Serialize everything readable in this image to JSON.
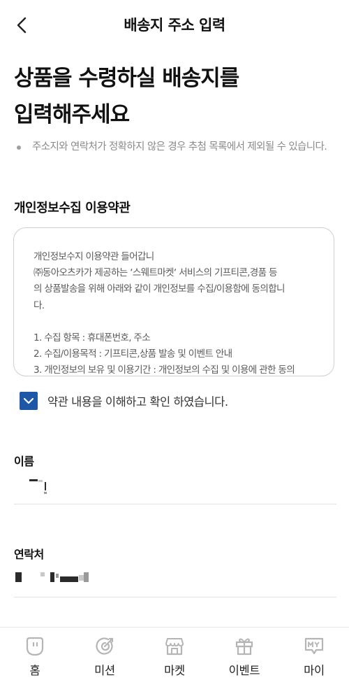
{
  "header": {
    "title": "배송지 주소 입력",
    "back_icon": "chevron-left-icon"
  },
  "headline": {
    "line1": "상품을 수령하실 배송지를",
    "line2": "입력해주세요"
  },
  "notice": {
    "text": "주소지와 연락처가 정확하지 않은 경우 추첨 목록에서 제외될 수 있습니다."
  },
  "terms": {
    "title": "개인정보수집 이용약관",
    "lines": [
      "개인정보수지 이용약관 들어갑니",
      "㈜동아오츠카가 제공하는 ‘스웨트마켓‘ 서비스의 기프티콘,경품 등",
      "의 상품발송을 위해 아래와 같이 개인정보를 수집/이용함에 동의합니",
      "다.",
      "",
      "1. 수집 항목 : 휴대폰번호, 주소",
      "2. 수집/이용목적 : 기프티콘,상품 발송 및 이벤트 안내",
      "3. 개인정보의 보유 및 이용기간 : 개인정보의 수집 및 이용에 관한 동의"
    ]
  },
  "agree": {
    "label": "약관 내용을 이해하고 확인 하였습니다.",
    "checked": true,
    "color": "#1f57a8"
  },
  "name_field": {
    "label": "이름"
  },
  "phone_field": {
    "label": "연락처"
  },
  "tabs": [
    {
      "label": "홈",
      "icon": "home-face-icon"
    },
    {
      "label": "미션",
      "icon": "mission-target-icon"
    },
    {
      "label": "마켓",
      "icon": "market-store-icon"
    },
    {
      "label": "이벤트",
      "icon": "event-gift-icon"
    },
    {
      "label": "마이",
      "icon": "my-badge-icon"
    }
  ]
}
